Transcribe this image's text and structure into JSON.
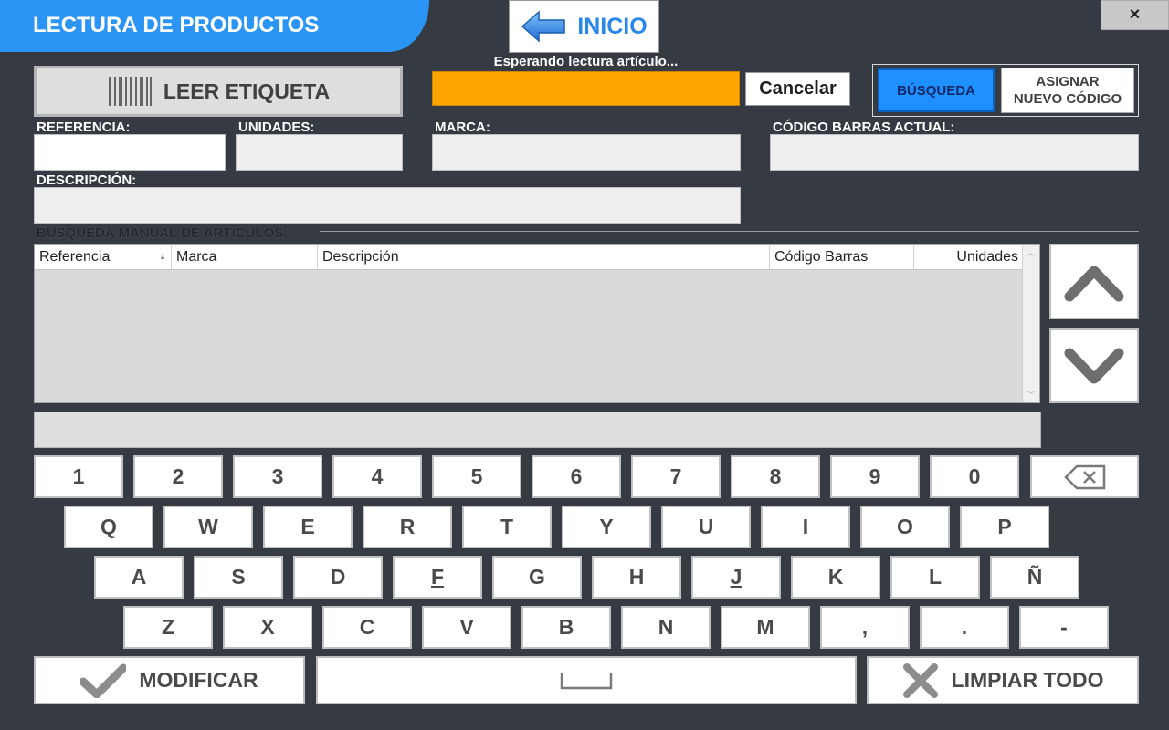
{
  "title": "LECTURA DE PRODUCTOS",
  "close_label": "×",
  "home_label": "INICIO",
  "read_label_button": "LEER ETIQUETA",
  "status_text": "Esperando lectura artículo...",
  "cancel_label": "Cancelar",
  "mode": {
    "search_label": "BÚSQUEDA",
    "assign_label_1": "ASIGNAR",
    "assign_label_2": "NUEVO CÓDIGO"
  },
  "fields": {
    "reference_label": "REFERENCIA:",
    "units_label": "UNIDADES:",
    "brand_label": "MARCA:",
    "barcode_label": "CÓDIGO BARRAS ACTUAL:",
    "description_label": "DESCRIPCIÓN:"
  },
  "manual_search_title": "BÚSQUEDA MANUAL DE ARTÍCULOS:",
  "grid": {
    "columns": [
      "Referencia",
      "Marca",
      "Descripción",
      "Código Barras",
      "Unidades"
    ],
    "sort_indicator": "▲"
  },
  "keyboard": {
    "row1": [
      "1",
      "2",
      "3",
      "4",
      "5",
      "6",
      "7",
      "8",
      "9",
      "0"
    ],
    "row2": [
      "Q",
      "W",
      "E",
      "R",
      "T",
      "Y",
      "U",
      "I",
      "O",
      "P"
    ],
    "row3": [
      "A",
      "S",
      "D",
      "F",
      "G",
      "H",
      "J",
      "K",
      "L",
      "Ñ"
    ],
    "row4": [
      "Z",
      "X",
      "C",
      "V",
      "B",
      "N",
      "M",
      ",",
      ".",
      "-"
    ]
  },
  "modify_label": "MODIFICAR",
  "clear_all_label": "LIMPIAR TODO",
  "colors": {
    "header_blue": "#2b95f5",
    "scan_orange": "#ffa500",
    "background": "#363a42",
    "mode_active": "#1e90ff"
  }
}
